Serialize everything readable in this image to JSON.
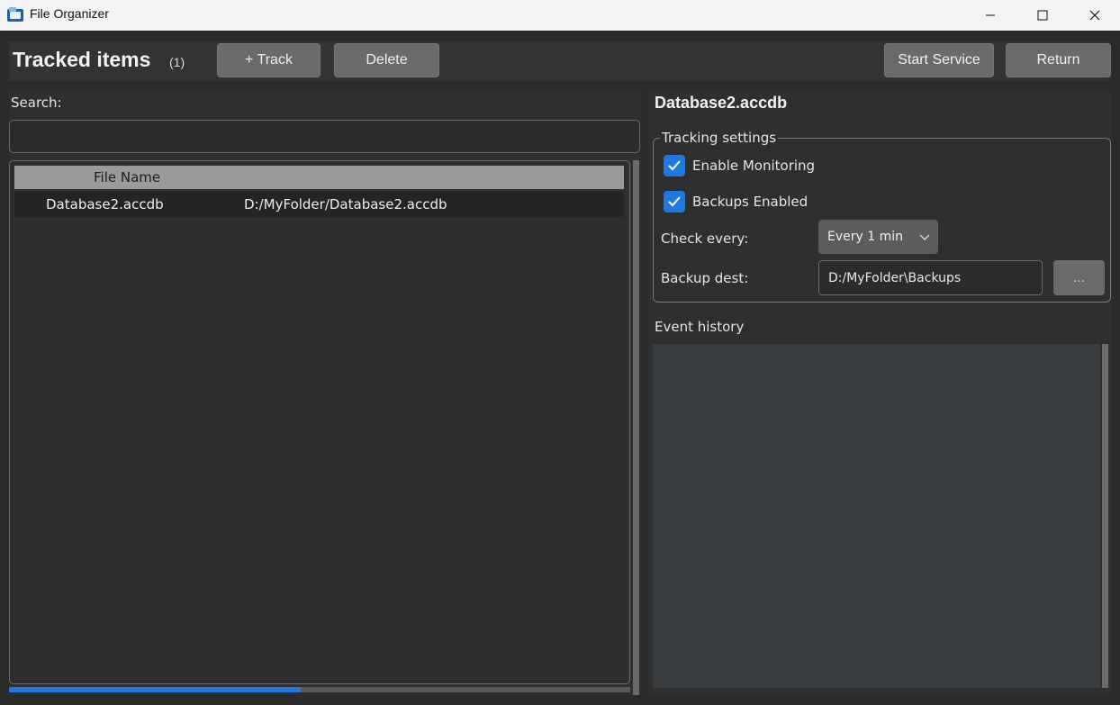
{
  "window": {
    "title": "File Organizer",
    "icon": "folder-app-icon",
    "controls": [
      "minimize-icon",
      "maximize-icon",
      "close-icon"
    ]
  },
  "header": {
    "title": "Tracked items",
    "count": "(1)",
    "track_label": "+ Track",
    "delete_label": "Delete",
    "start_service_label": "Start Service",
    "return_label": "Return"
  },
  "left": {
    "search_label": "Search:",
    "search_value": "",
    "table": {
      "columns": [
        "File Name",
        ""
      ],
      "rows": [
        {
          "name": "Database2.accdb",
          "path": "D:/MyFolder/Database2.accdb"
        }
      ]
    },
    "hscroll_fraction": 0.47
  },
  "right": {
    "selected_file": "Database2.accdb",
    "tracking_settings": {
      "title": "Tracking settings",
      "enable_monitoring": {
        "label": "Enable Monitoring",
        "checked": true
      },
      "backups_enabled": {
        "label": "Backups Enabled",
        "checked": true
      },
      "check_every_label": "Check every:",
      "check_every_value": "Every 1 min",
      "backup_dest_label": "Backup dest:",
      "backup_dest_value": "D:/MyFolder\\Backups",
      "browse_label": "..."
    },
    "event_history_label": "Event history"
  },
  "colors": {
    "accent": "#1f7ae0",
    "background": "#2b2b2b",
    "button": "#6a6a6a"
  }
}
